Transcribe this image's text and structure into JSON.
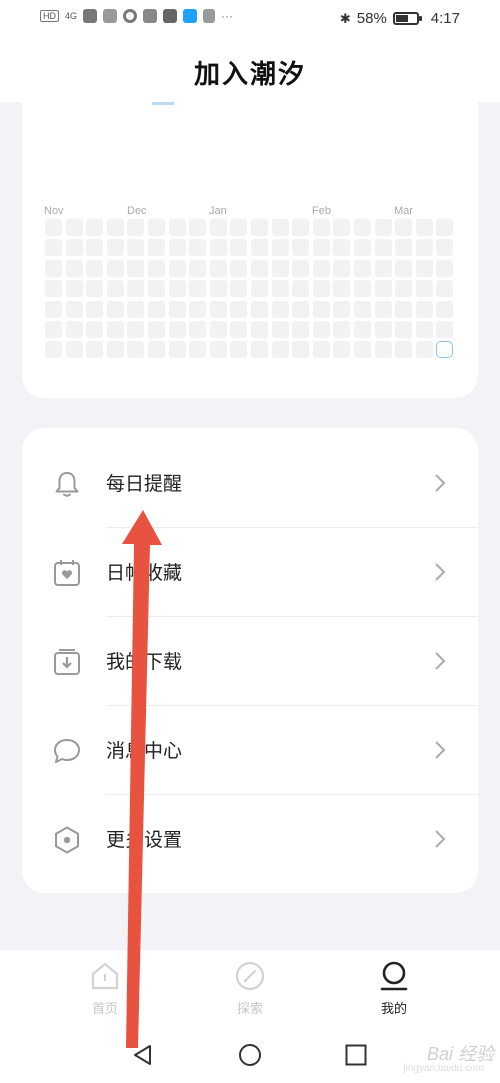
{
  "status_bar": {
    "network": "HD",
    "signal": "4G",
    "battery_percent": "58%",
    "battery_level": 0.58,
    "time": "4:17"
  },
  "header": {
    "title": "加入潮汐"
  },
  "calendar": {
    "months": [
      "Nov",
      "Dec",
      "Jan",
      "Feb",
      "Mar"
    ],
    "rows": 7,
    "columns": 20,
    "highlight_color": "#8ec3e8"
  },
  "menu": {
    "items": [
      {
        "label": "每日提醒",
        "icon": "bell-icon"
      },
      {
        "label": "日帖收藏",
        "icon": "calendar-heart-icon"
      },
      {
        "label": "我的下载",
        "icon": "download-box-icon"
      },
      {
        "label": "消息中心",
        "icon": "chat-bubble-icon"
      },
      {
        "label": "更多设置",
        "icon": "hexagon-settings-icon"
      }
    ]
  },
  "bottom_nav": {
    "items": [
      {
        "label": "首页",
        "icon": "home-icon",
        "active": false
      },
      {
        "label": "探索",
        "icon": "compass-icon",
        "active": false
      },
      {
        "label": "我的",
        "icon": "profile-icon",
        "active": true
      }
    ]
  },
  "watermark": {
    "text": "Bai 经验",
    "sub": "jingyan.baidu.com"
  },
  "annotation_color": "#e8533f"
}
